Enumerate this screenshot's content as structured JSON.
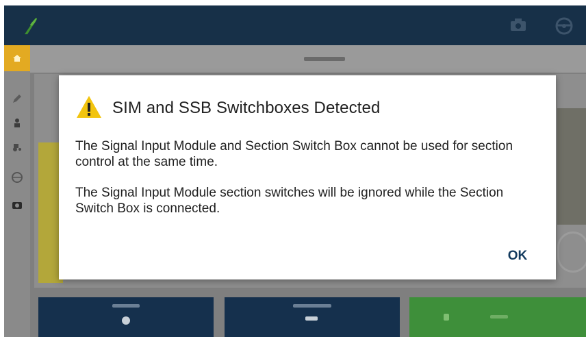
{
  "dialog": {
    "title": "SIM and SSB Switchboxes Detected",
    "paragraphs": [
      "The Signal Input Module and Section Switch Box cannot be used for section control at the same time.",
      "The Signal Input Module section switches will be ignored while the Section Switch Box is connected."
    ],
    "ok_label": "OK"
  },
  "icons": {
    "dialog": "warning-icon",
    "topbar_left": "leaf-icon",
    "topbar_right": [
      "camera-icon",
      "steering-wheel-icon"
    ],
    "rail": [
      "home-icon",
      "edit-icon",
      "person-icon",
      "tractor-icon",
      "globe-icon",
      "camera-icon"
    ]
  },
  "colors": {
    "topbar": "#173048",
    "accent_yellow": "#e3aa22",
    "warning_yellow": "#f2c40f",
    "ok_text": "#123a5e",
    "bottom_button_blue": "#15304d",
    "bottom_button_green": "#3e8f3a"
  }
}
